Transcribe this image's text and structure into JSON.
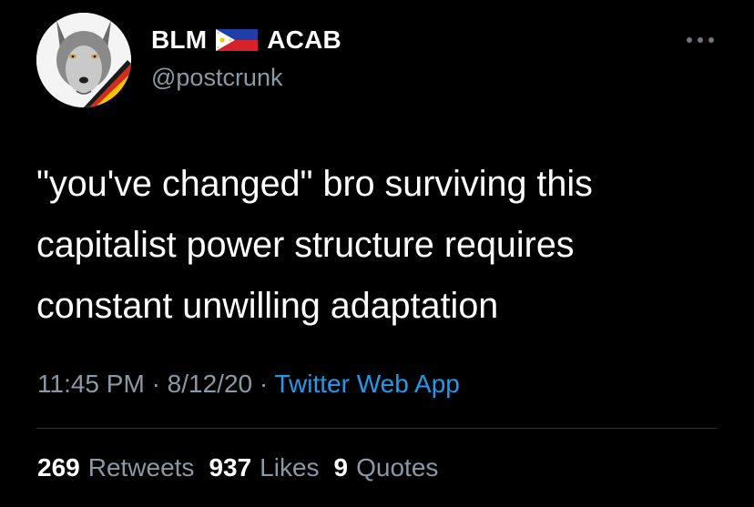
{
  "author": {
    "name_part1": "BLM",
    "flag_icon": "philippines-flag-icon",
    "name_part2": "ACAB",
    "handle": "@postcrunk",
    "avatar_icon": "wolf-avatar"
  },
  "tweet": {
    "lines": [
      "\"you've changed\" bro surviving this",
      "capitalist power structure requires",
      "constant unwilling adaptation"
    ],
    "time": "11:45 PM",
    "date": "8/12/20",
    "separator": "·",
    "source": "Twitter Web App"
  },
  "stats": {
    "retweets": {
      "count": "269",
      "label": "Retweets"
    },
    "likes": {
      "count": "937",
      "label": "Likes"
    },
    "quotes": {
      "count": "9",
      "label": "Quotes"
    }
  },
  "colors": {
    "background": "#000000",
    "text": "#ffffff",
    "secondary": "#8b98a5",
    "link": "#1d9bf0"
  }
}
